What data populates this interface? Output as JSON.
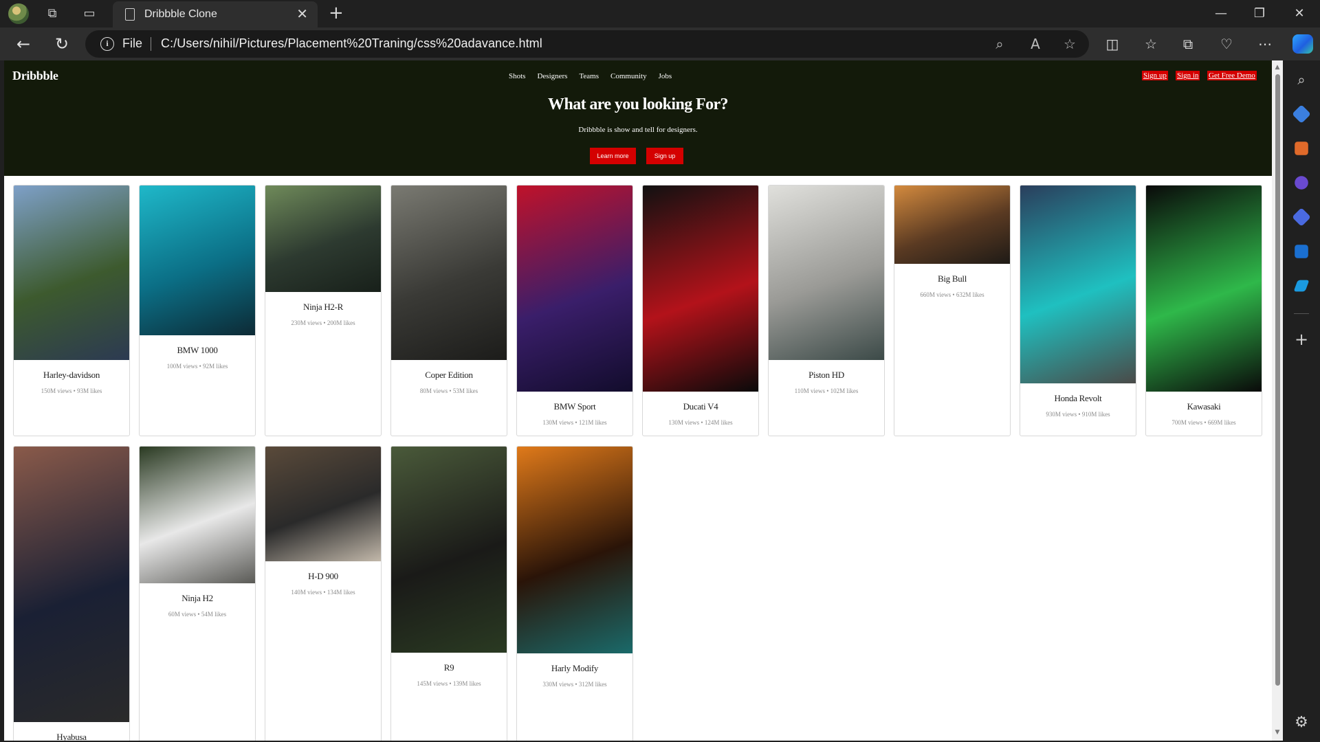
{
  "browser": {
    "tab_title": "Dribbble Clone",
    "file_label": "File",
    "url": "C:/Users/nihil/Pictures/Placement%20Traning/css%20adavance.html"
  },
  "site": {
    "brand": "Dribbble",
    "menu": [
      "Shots",
      "Designers",
      "Teams",
      "Community",
      "Jobs"
    ],
    "sign_up": "Sign up",
    "sign_in": "Sign in",
    "get_demo": "Get Free Demo",
    "hero_title": "What are you looking For?",
    "hero_subtitle": "Dribbble is show and tell for designers.",
    "learn_more": "Learn more",
    "hero_signup": "Sign up"
  },
  "cards": [
    {
      "name": "Harley-davidson",
      "stats": "150M views • 93M likes",
      "colors": [
        "#7ea0c8",
        "#3d5a2e",
        "#2c3a52"
      ]
    },
    {
      "name": "BMW 1000",
      "stats": "100M views • 92M likes",
      "colors": [
        "#1fb8c9",
        "#0b6f86",
        "#0d2a35"
      ]
    },
    {
      "name": "Ninja H2-R",
      "stats": "230M views • 200M likes",
      "colors": [
        "#6f8a5a",
        "#2d3a30",
        "#18201a"
      ]
    },
    {
      "name": "Coper Edition",
      "stats": "80M views • 53M likes",
      "colors": [
        "#7a7a72",
        "#3a3a36",
        "#1c1c1a"
      ]
    },
    {
      "name": "BMW Sport",
      "stats": "130M views • 121M likes",
      "colors": [
        "#c0122a",
        "#3a1e6a",
        "#120c2c"
      ]
    },
    {
      "name": "Ducati V4",
      "stats": "130M views • 124M likes",
      "colors": [
        "#111111",
        "#b3121a",
        "#0a0a0a"
      ]
    },
    {
      "name": "Piston HD",
      "stats": "110M views • 102M likes",
      "colors": [
        "#e0e0dc",
        "#9a9a96",
        "#3c4a48"
      ]
    },
    {
      "name": "Big Bull",
      "stats": "660M views • 632M likes",
      "colors": [
        "#d38a3e",
        "#5a3a22",
        "#1e1a16"
      ]
    },
    {
      "name": "Honda Revolt",
      "stats": "930M views • 910M likes",
      "colors": [
        "#2a3e5c",
        "#1fc0c0",
        "#4a4a48"
      ]
    },
    {
      "name": "Kawasaki",
      "stats": "700M views • 669M likes",
      "colors": [
        "#0a0a0a",
        "#2fb84a",
        "#0a0a0a"
      ]
    },
    {
      "name": "Hyabusa",
      "stats": "",
      "colors": [
        "#8a5a4a",
        "#1a2034",
        "#2a2a2a"
      ]
    },
    {
      "name": "Ninja H2",
      "stats": "60M views • 54M likes",
      "colors": [
        "#2a3a22",
        "#e8e8e8",
        "#5a5a56"
      ]
    },
    {
      "name": "H-D 900",
      "stats": "140M views • 134M likes",
      "colors": [
        "#5a4a3a",
        "#2a2a2a",
        "#c2b8aa"
      ]
    },
    {
      "name": "R9",
      "stats": "145M views • 139M likes",
      "colors": [
        "#4a5a3a",
        "#1a1a18",
        "#2a3a22"
      ]
    },
    {
      "name": "Harly Modify",
      "stats": "330M views • 312M likes",
      "colors": [
        "#e07a1a",
        "#2a1408",
        "#1a6a6a"
      ]
    }
  ]
}
